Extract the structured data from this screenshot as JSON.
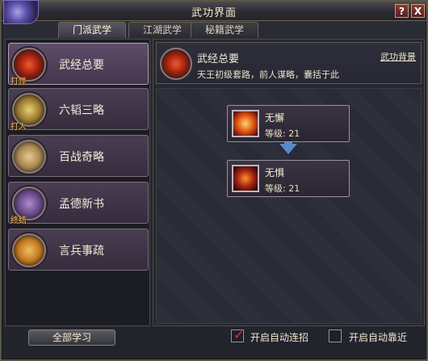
{
  "window": {
    "title": "武功界面",
    "help_label": "?",
    "close_label": "X"
  },
  "tabs": [
    {
      "label": "门派武学",
      "active": true
    },
    {
      "label": "江湖武学",
      "active": false
    },
    {
      "label": "秘籍武学",
      "active": false
    }
  ],
  "skills": [
    {
      "label": "武经总要",
      "tag": "打怪",
      "icon": "red-crest-icon",
      "active": true
    },
    {
      "label": "六韬三略",
      "tag": "打人",
      "icon": "gold-book-icon",
      "active": false
    },
    {
      "label": "百战奇略",
      "tag": "",
      "icon": "scroll-icon",
      "active": false
    },
    {
      "label": "孟德新书",
      "tag": "终结",
      "icon": "purple-book-icon",
      "active": false
    },
    {
      "label": "言兵事疏",
      "tag": "",
      "icon": "letter-icon",
      "active": false
    }
  ],
  "all_learn_label": "全部学习",
  "info": {
    "title": "武经总要",
    "description": "天王初级套路，前人谋略，囊括于此",
    "background_link": "武功背景"
  },
  "tree": [
    {
      "name": "无懈",
      "level_text": "等级: 21",
      "icon": "fire-blade-icon"
    },
    {
      "name": "无惧",
      "level_text": "等级: 21",
      "icon": "demon-face-icon"
    }
  ],
  "options": {
    "auto_combo_label": "开启自动连招",
    "auto_combo_checked": true,
    "auto_approach_label": "开启自动靠近",
    "auto_approach_checked": false
  },
  "colors": {
    "accent_check": "#e0302a",
    "arrow": "#5a8ac8",
    "gold_tag": "#e8c040"
  }
}
